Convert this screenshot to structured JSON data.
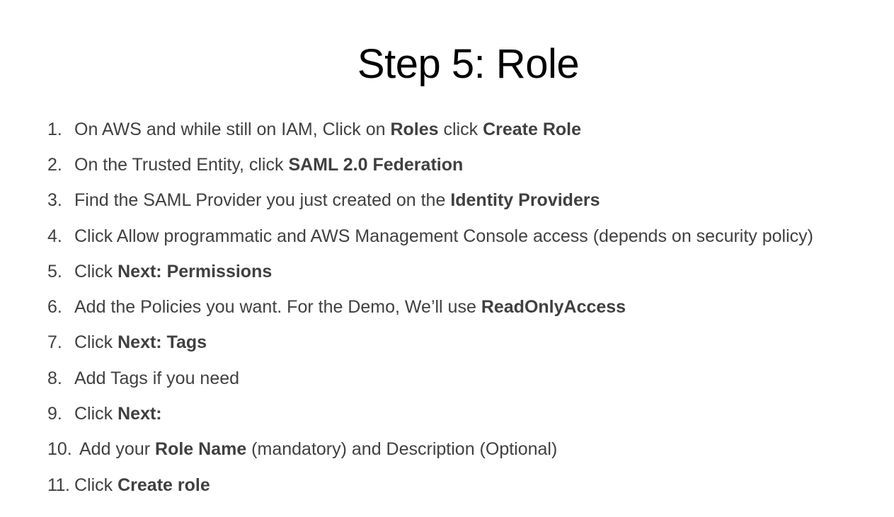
{
  "title": "Step 5: Role",
  "steps": [
    {
      "num": "1.",
      "parts": [
        {
          "t": "On AWS and while still on IAM, Click on ",
          "b": false
        },
        {
          "t": "Roles",
          "b": true
        },
        {
          "t": " click ",
          "b": false
        },
        {
          "t": "Create Role",
          "b": true
        }
      ]
    },
    {
      "num": "2.",
      "parts": [
        {
          "t": "On the Trusted Entity, click ",
          "b": false
        },
        {
          "t": "SAML 2.0 Federation",
          "b": true
        }
      ]
    },
    {
      "num": "3.",
      "parts": [
        {
          "t": "Find the SAML Provider you just created on the ",
          "b": false
        },
        {
          "t": "Identity Providers",
          "b": true
        }
      ]
    },
    {
      "num": "4.",
      "parts": [
        {
          "t": "Click Allow programmatic and AWS Management Console access (depends on security policy)",
          "b": false
        }
      ]
    },
    {
      "num": "5.",
      "parts": [
        {
          "t": "Click ",
          "b": false
        },
        {
          "t": "Next: Permissions",
          "b": true
        }
      ]
    },
    {
      "num": "6.",
      "parts": [
        {
          "t": "Add the Policies you want. For the Demo, We’ll use ",
          "b": false
        },
        {
          "t": "ReadOnlyAccess",
          "b": true
        }
      ]
    },
    {
      "num": "7.",
      "parts": [
        {
          "t": "Click ",
          "b": false
        },
        {
          "t": "Next: Tags",
          "b": true
        }
      ]
    },
    {
      "num": "8.",
      "parts": [
        {
          "t": "Add Tags if you need",
          "b": false
        }
      ]
    },
    {
      "num": "9.",
      "parts": [
        {
          "t": "Click ",
          "b": false
        },
        {
          "t": "Next:",
          "b": true
        }
      ]
    },
    {
      "num": "10.",
      "parts": [
        {
          "t": "Add your ",
          "b": false
        },
        {
          "t": "Role Name",
          "b": true
        },
        {
          "t": " (mandatory) and Description (Optional)",
          "b": false
        }
      ]
    },
    {
      "num": "11.",
      "parts": [
        {
          "t": "Click ",
          "b": false
        },
        {
          "t": "Create role",
          "b": true
        }
      ]
    }
  ]
}
